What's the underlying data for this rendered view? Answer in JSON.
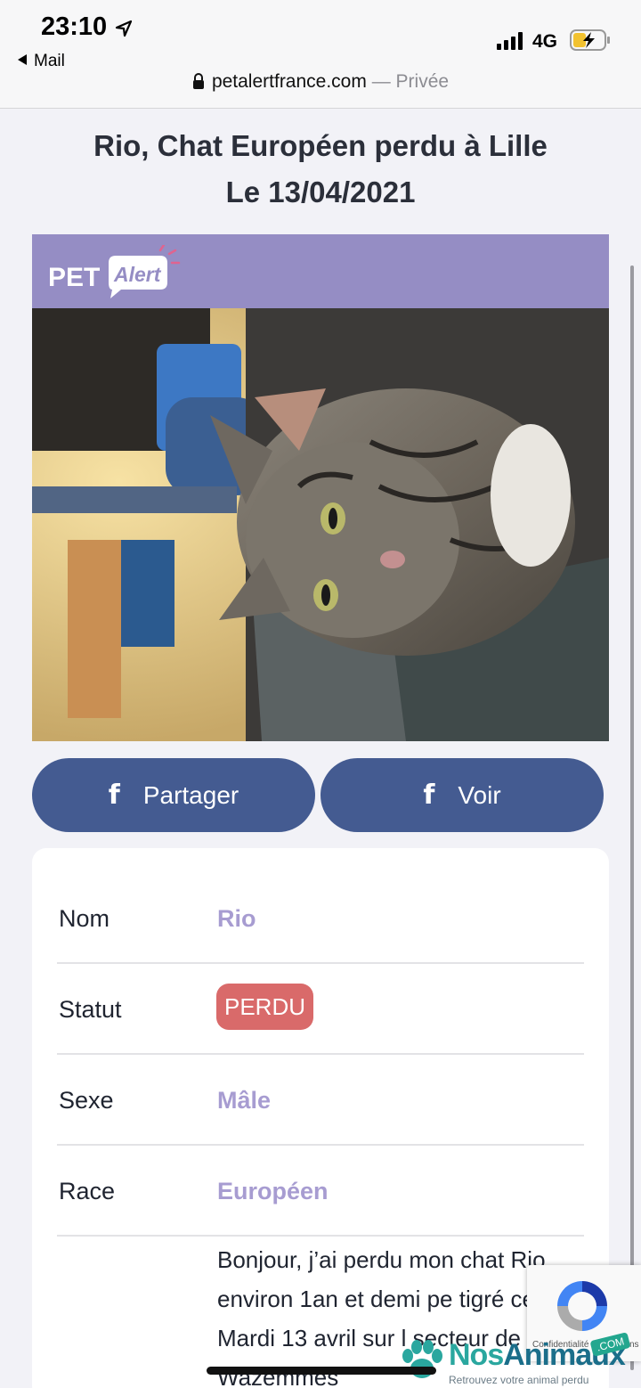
{
  "status_bar": {
    "time": "23:10",
    "back_app": "Mail",
    "network": "4G"
  },
  "browser": {
    "domain": "petalertfrance.com",
    "mode": "— Privée"
  },
  "page": {
    "title_line1": "Rio, Chat Européen perdu à Lille",
    "title_line2": "Le 13/04/2021"
  },
  "brand": {
    "logo_text_1": "PET",
    "logo_text_2": "Alert",
    "color": "#958dc4"
  },
  "share": {
    "share_label": "Partager",
    "view_label": "Voir",
    "icon": "facebook-icon",
    "color": "#445b91"
  },
  "details": {
    "rows": [
      {
        "label": "Nom",
        "value": "Rio"
      },
      {
        "label": "Statut",
        "value": "PERDU"
      },
      {
        "label": "Sexe",
        "value": "Mâle"
      },
      {
        "label": "Race",
        "value": "Européen"
      }
    ],
    "description": "Bonjour, j’ai perdu mon chat Rio environ 1an et demi pe tigré ce Mardi 13 avril sur l secteur de Wazemmes",
    "status_color": "#d96a6a",
    "value_color": "#a79cd1"
  },
  "recaptcha": {
    "text": "Confidentialité - Conditions"
  },
  "watermark": {
    "name_1": "Nos",
    "name_2": "Animaux",
    "com": ".COM",
    "tagline": "Retrouvez votre animal perdu"
  }
}
